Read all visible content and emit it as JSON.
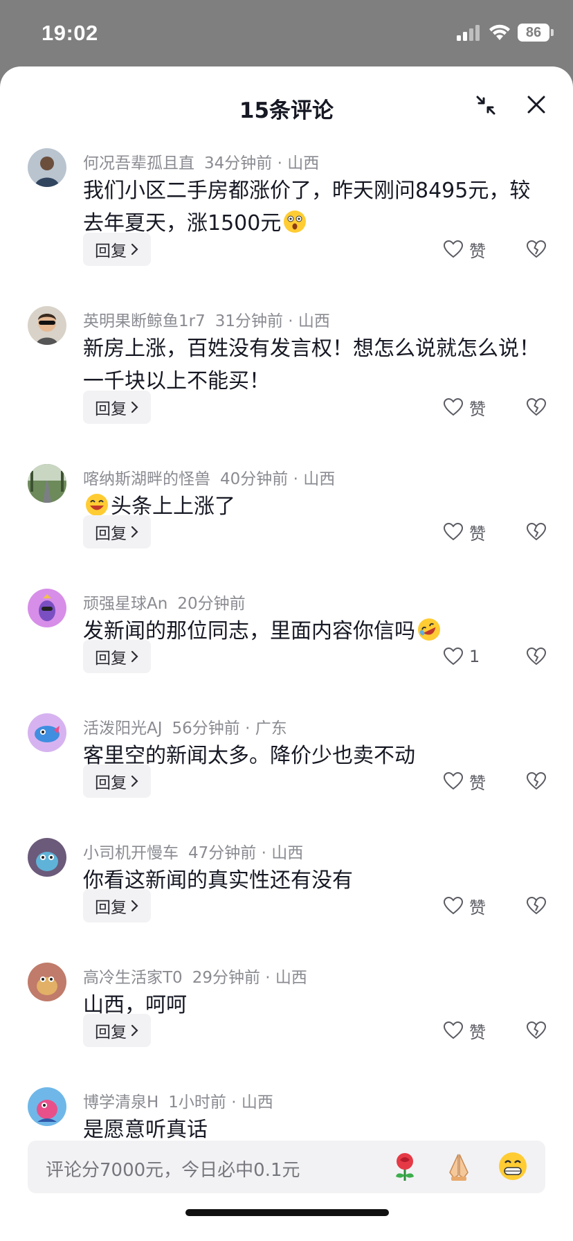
{
  "status_bar": {
    "time": "19:02",
    "battery": "86"
  },
  "header": {
    "title": "15条评论"
  },
  "comments": [
    {
      "user": "何况吾辈孤且直",
      "time": "34分钟前 · 山西",
      "text_1": "我们小区二手房都涨价了，昨天刚问8495元，较去年夏天，涨1500元",
      "emoji": "shocked-face-emoji",
      "like_label": "赞",
      "reply_label": "回复"
    },
    {
      "user": "英明果断鲸鱼1r7",
      "time": "31分钟前 · 山西",
      "text_1": "新房上涨，百姓没有发言权！想怎么说就怎么说！一千块以上不能买！",
      "like_label": "赞",
      "reply_label": "回复"
    },
    {
      "user": "喀纳斯湖畔的怪兽",
      "time": "40分钟前 · 山西",
      "text_1": "头条上上涨了",
      "emoji": "laughing-face-emoji",
      "like_label": "赞",
      "reply_label": "回复"
    },
    {
      "user": "顽强星球An",
      "time": "20分钟前",
      "text_1": "发新闻的那位同志，里面内容你信吗",
      "emoji": "rofl-face-emoji",
      "like_label": "1",
      "reply_label": "回复"
    },
    {
      "user": "活泼阳光AJ",
      "time": "56分钟前 · 广东",
      "text_1": "客里空的新闻太多。降价少也卖不动",
      "like_label": "赞",
      "reply_label": "回复"
    },
    {
      "user": "小司机开慢车",
      "time": "47分钟前 · 山西",
      "text_1": "你看这新闻的真实性还有没有",
      "like_label": "赞",
      "reply_label": "回复"
    },
    {
      "user": "高冷生活家T0",
      "time": "29分钟前 · 山西",
      "text_1": "山西，呵呵",
      "like_label": "赞",
      "reply_label": "回复"
    },
    {
      "user": "博学清泉H",
      "time": "1小时前 · 山西",
      "text_1": "是愿意听真话"
    }
  ],
  "input": {
    "placeholder": "评论分7000元，今日必中0.1元",
    "emojis": [
      "rose-emoji",
      "pray-hands-emoji",
      "grin-face-emoji"
    ]
  },
  "colors": {
    "text": "#161823",
    "meta": "#8a8b91",
    "reply_bg": "#f2f2f4",
    "dim": "#7f7f7f"
  }
}
